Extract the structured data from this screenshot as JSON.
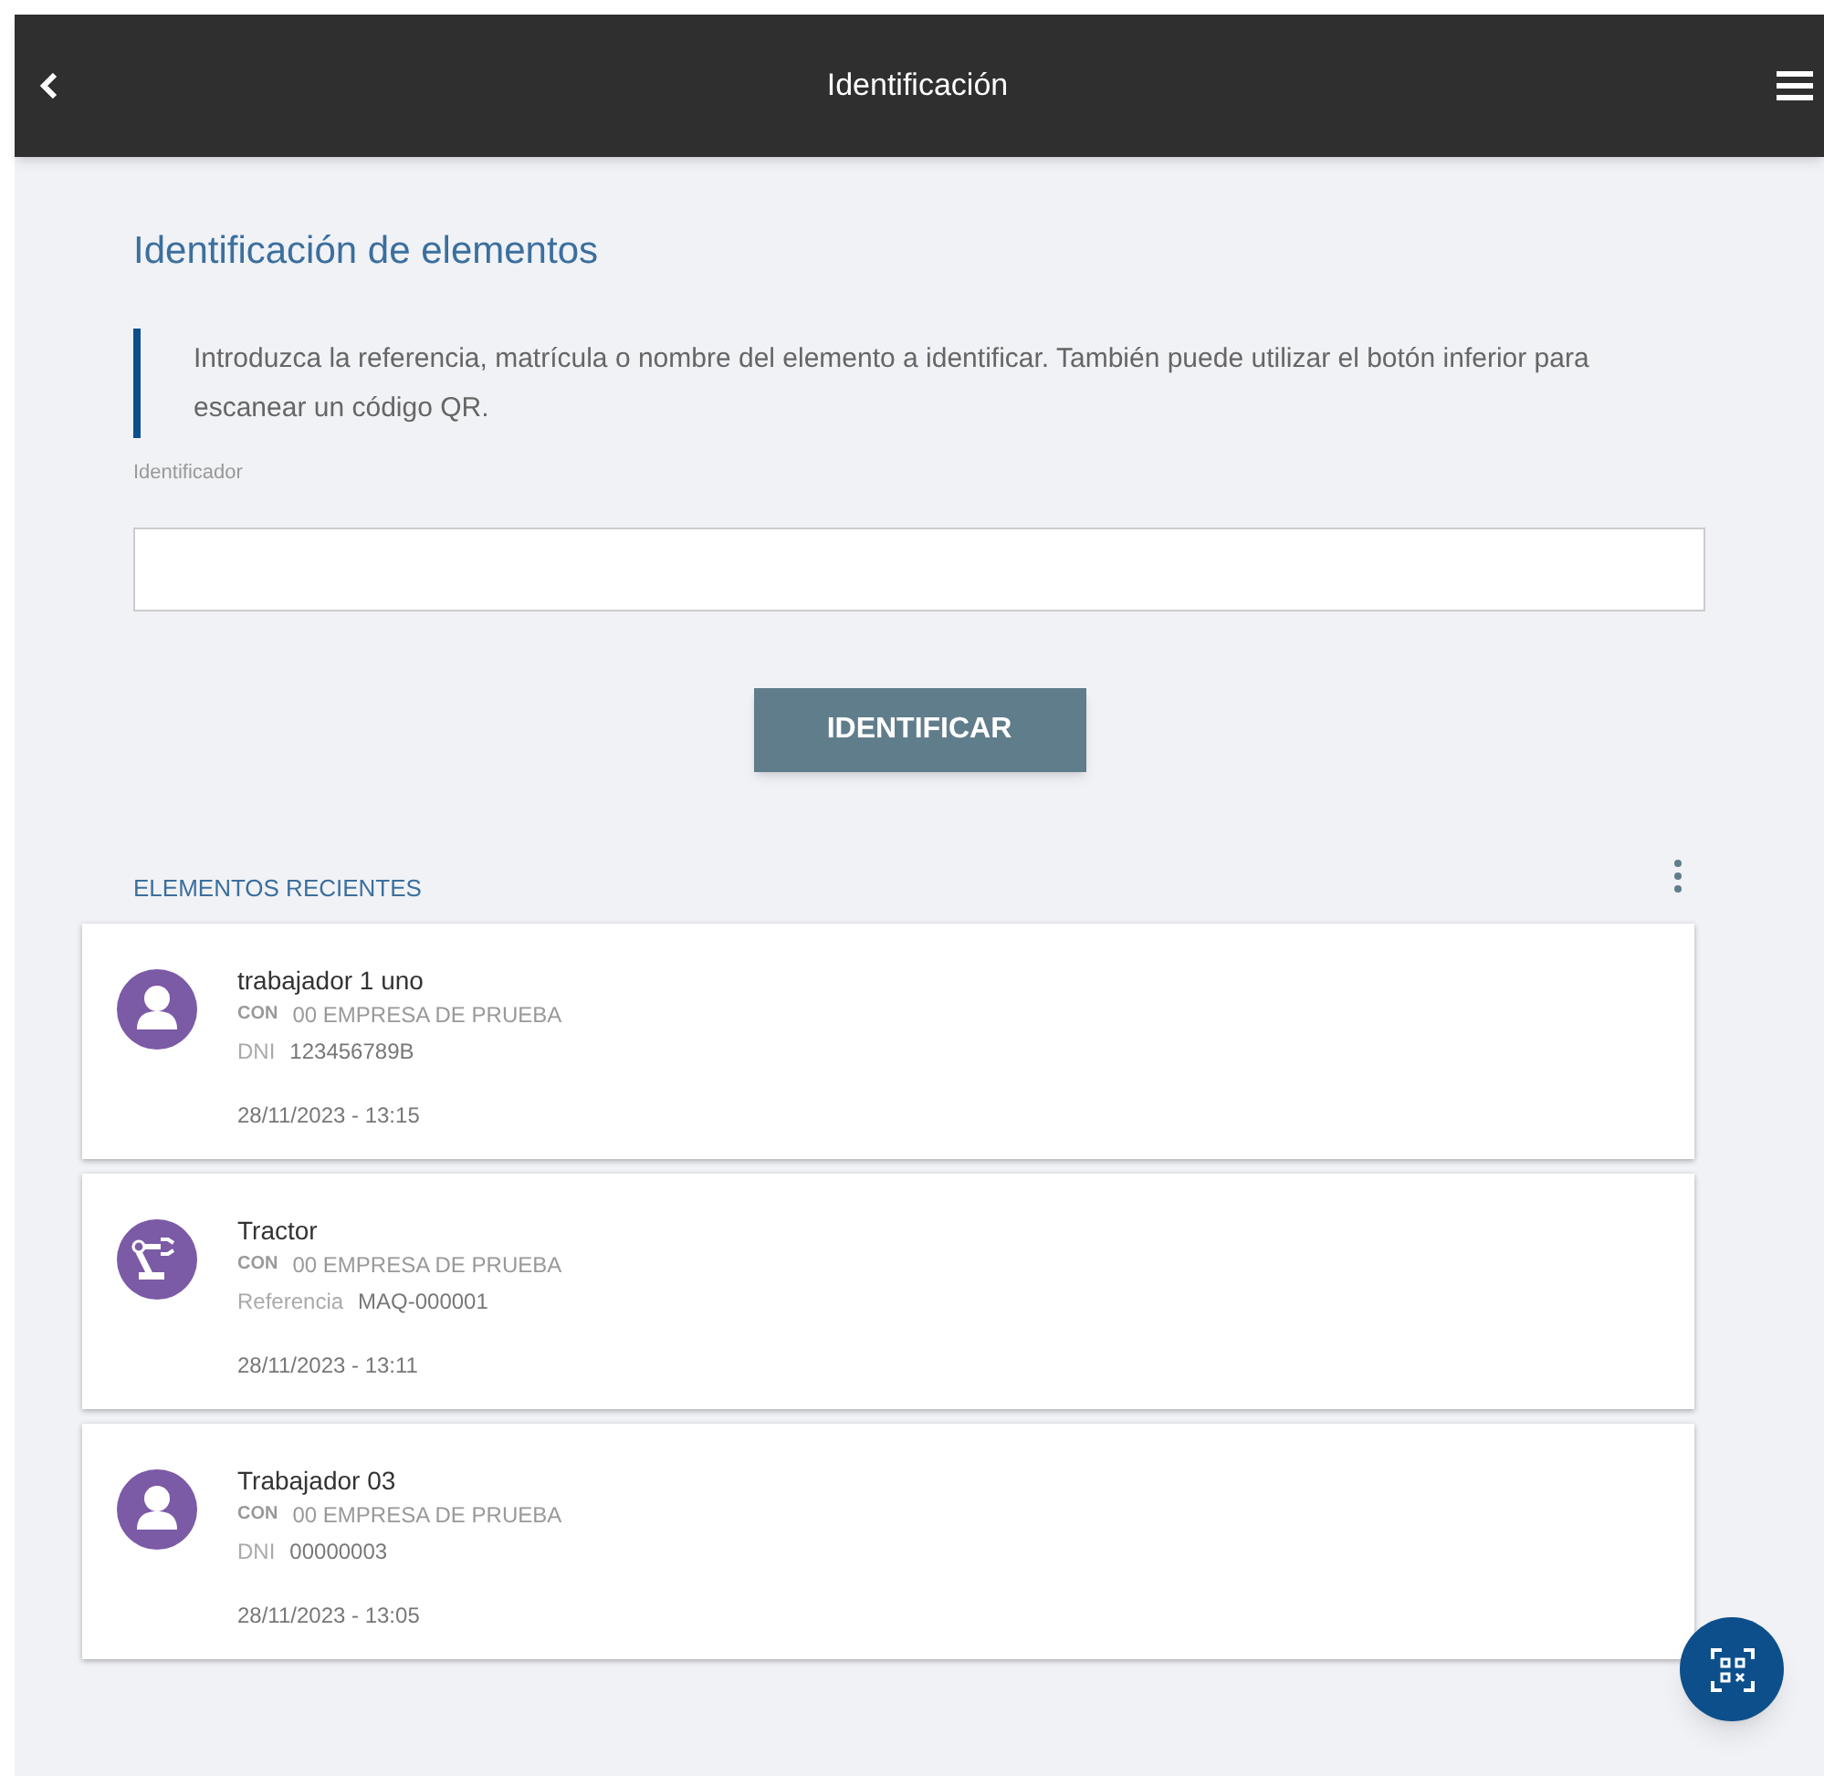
{
  "header": {
    "title": "Identificación"
  },
  "heading": "Identificación de elementos",
  "instructions": "Introduzca la referencia, matrícula o nombre del elemento a identificar. También puede utilizar el botón inferior para escanear un código QR.",
  "field": {
    "label": "Identificador"
  },
  "button": "IDENTIFICAR",
  "recent": {
    "title": "ELEMENTOS RECIENTES",
    "items": [
      {
        "kind": "person",
        "name": "trabajador 1 uno",
        "company_label": "CON",
        "company": "00 EMPRESA DE PRUEBA",
        "id_label": "DNI",
        "id_value": "123456789B",
        "date": "28/11/2023 - 13:15"
      },
      {
        "kind": "machine",
        "name": "Tractor",
        "company_label": "CON",
        "company": "00 EMPRESA DE PRUEBA",
        "id_label": "Referencia",
        "id_value": "MAQ-000001",
        "date": "28/11/2023 - 13:11"
      },
      {
        "kind": "person",
        "name": "Trabajador 03",
        "company_label": "CON",
        "company": "00 EMPRESA DE PRUEBA",
        "id_label": "DNI",
        "id_value": "00000003",
        "date": "28/11/2023 - 13:05"
      }
    ]
  }
}
